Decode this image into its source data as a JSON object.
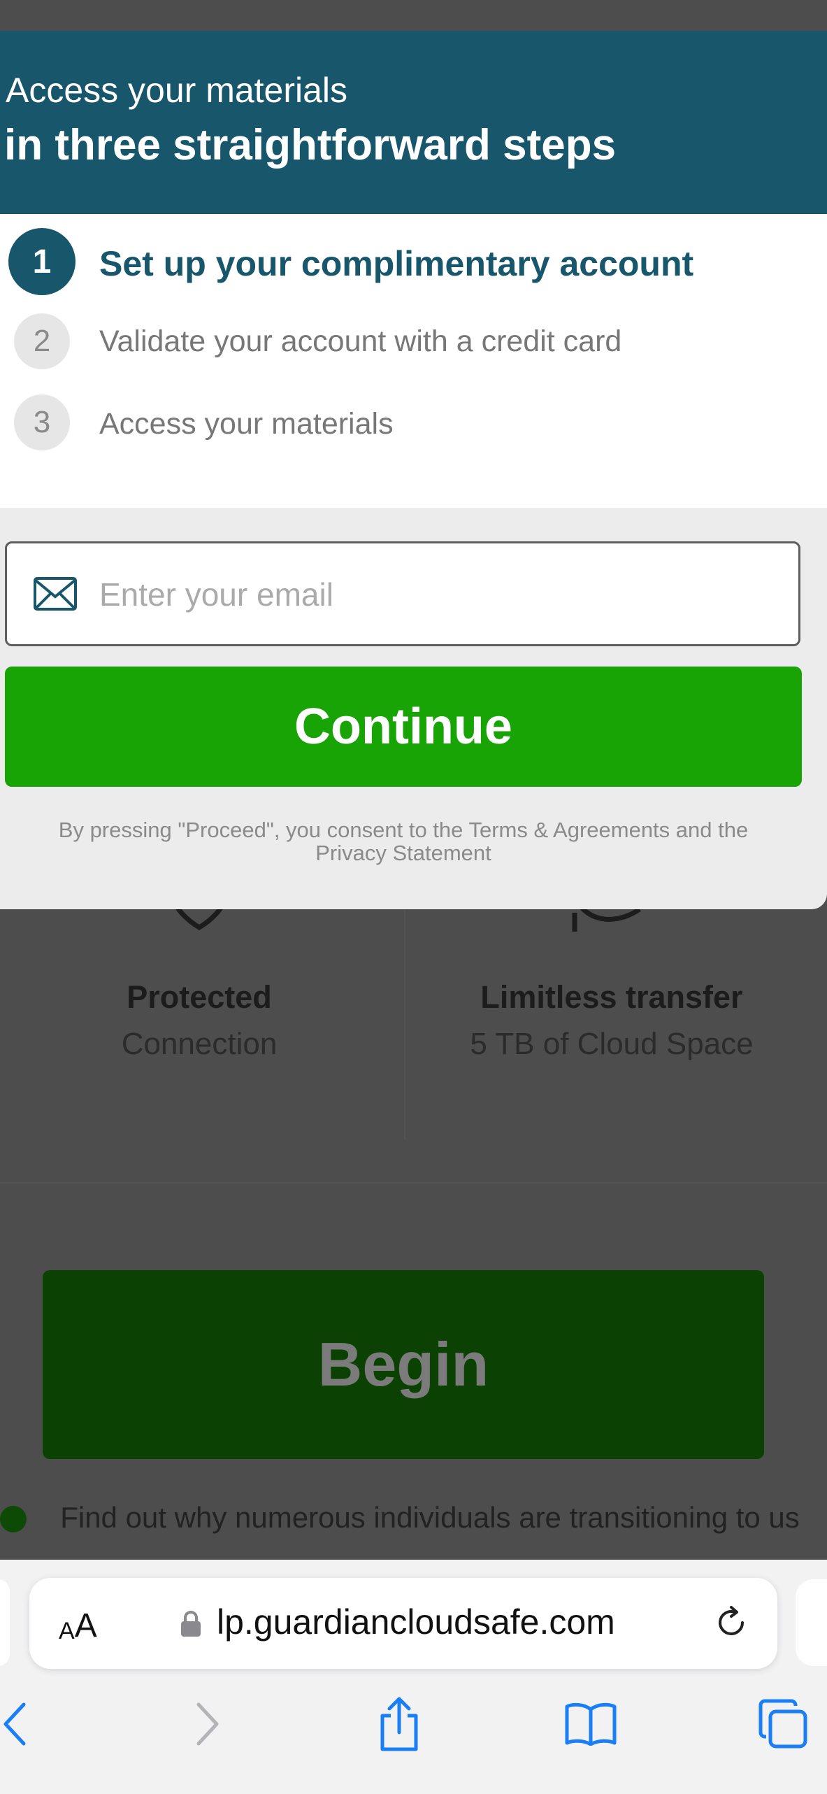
{
  "modal": {
    "subtitle": "Access your materials",
    "title": "in three straightforward steps",
    "steps": [
      {
        "number": "1",
        "label": "Set up your complimentary account"
      },
      {
        "number": "2",
        "label": "Validate your account with a credit card"
      },
      {
        "number": "3",
        "label": "Access your materials"
      }
    ],
    "email_placeholder": "Enter your email",
    "continue_label": "Continue",
    "consent_text": "By pressing \"Proceed\", you consent to the Terms & Agreements and the Privacy Statement"
  },
  "background": {
    "features": [
      {
        "title": "Protected",
        "subtitle": "Connection",
        "icon": "shield-icon"
      },
      {
        "title": "Limitless transfer",
        "subtitle": "5 TB of Cloud Space",
        "icon": "cloud-refresh-icon"
      }
    ],
    "begin_label": "Begin",
    "bullet_text": "Find out why numerous individuals are transitioning to us"
  },
  "browser": {
    "text_size_label_small": "A",
    "text_size_label_big": "A",
    "url": "lp.guardiancloudsafe.com",
    "toolbar_icons": [
      "back-icon",
      "forward-icon",
      "share-icon",
      "bookmarks-icon",
      "tabs-icon"
    ]
  },
  "colors": {
    "brand_teal": "#18576b",
    "continue_green": "#19a406",
    "ios_blue": "#1a7ef5"
  }
}
